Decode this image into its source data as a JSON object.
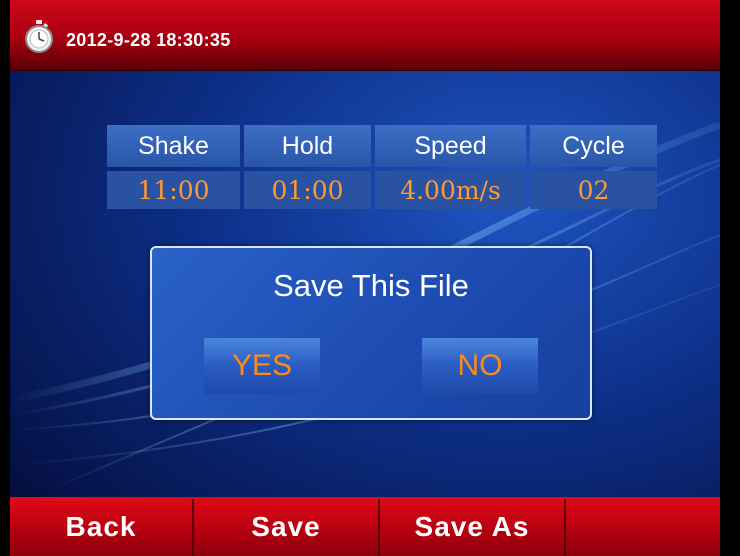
{
  "header": {
    "datetime": "2012-9-28  18:30:35",
    "icon": "stopwatch-icon"
  },
  "params": {
    "headers": [
      "Shake",
      "Hold",
      "Speed",
      "Cycle"
    ],
    "values": [
      "11:00",
      "01:00",
      "4.00m/s",
      "02"
    ]
  },
  "dialog": {
    "title": "Save This File",
    "yes_label": "YES",
    "no_label": "NO"
  },
  "softkeys": {
    "back": "Back",
    "save": "Save",
    "save_as": "Save As",
    "empty": ""
  },
  "colors": {
    "bar_red": "#c4000f",
    "background_blue": "#0d2e86",
    "value_orange": "#ff9a2e",
    "dialog_button_text": "#ff8a1c"
  }
}
